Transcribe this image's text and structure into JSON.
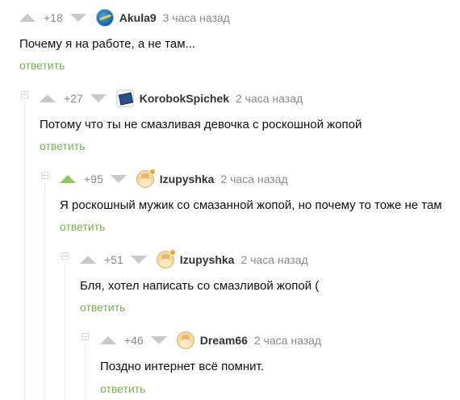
{
  "comments": [
    {
      "rating": "+18",
      "username": "Akula9",
      "time": "3 часа назад",
      "text": "Почему я на работе, а не там...",
      "reply": "ответить",
      "avatar": "globe-avatar",
      "upvoted": false
    },
    {
      "rating": "+27",
      "username": "KorobokSpichek",
      "time": "2 часа назад",
      "text": "Потому что ты не смазливая девочка с роскошной жопой",
      "reply": "ответить",
      "avatar": "device-avatar",
      "upvoted": false
    },
    {
      "rating": "+95",
      "username": "Izupyshka",
      "time": "2 часа назад",
      "text": "Я роскошный мужик со смазанной жопой, но почему то тоже не там",
      "reply": "ответить",
      "avatar": "face-avatar",
      "upvoted": true
    },
    {
      "rating": "+51",
      "username": "Izupyshka",
      "time": "2 часа назад",
      "text": "Бля, хотел написать со смазливой жопой (",
      "reply": "ответить",
      "avatar": "face-avatar",
      "upvoted": false
    },
    {
      "rating": "+46",
      "username": "Dream66",
      "time": "2 часа назад",
      "text": "Поздно интернет всё помнит.",
      "reply": "ответить",
      "avatar": "face-avatar",
      "upvoted": false
    }
  ],
  "colors": {
    "accent": "#79b24a",
    "upvote_active": "#8ac858",
    "muted": "#8a8a8a"
  }
}
